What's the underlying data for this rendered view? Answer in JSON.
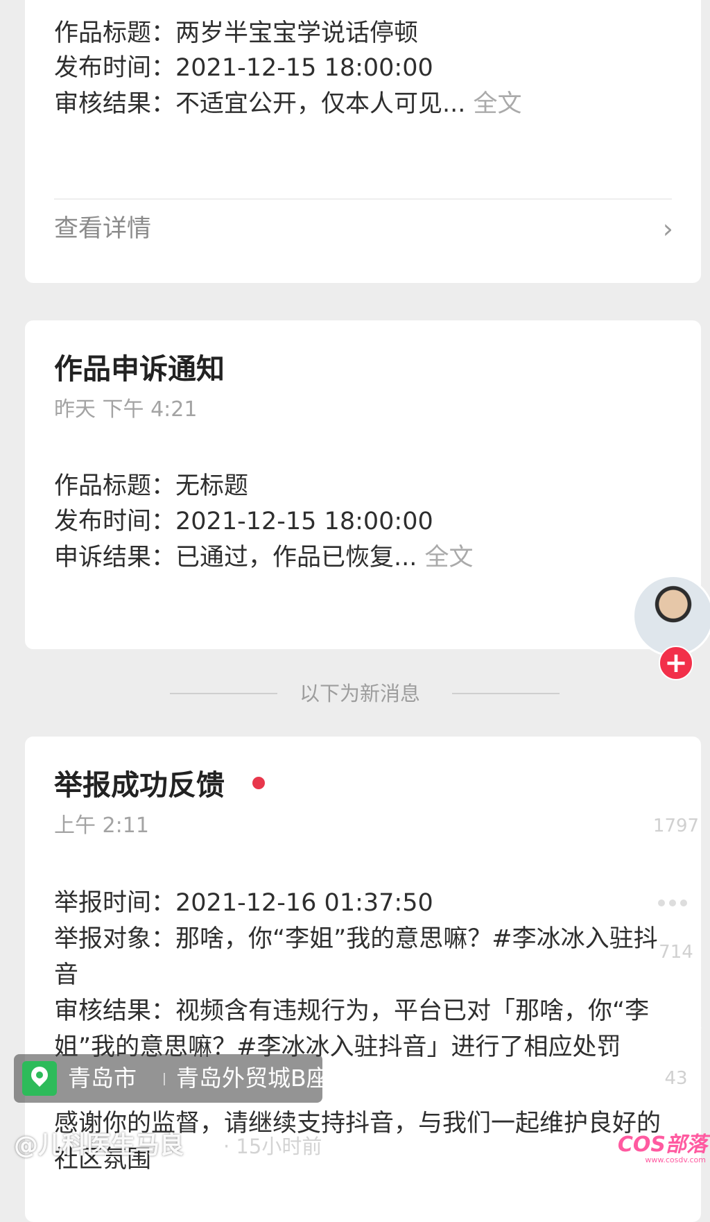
{
  "card1": {
    "lines": [
      {
        "label": "作品标题：",
        "value": "两岁半宝宝学说话停顿"
      },
      {
        "label": "发布时间：",
        "value": "2021-12-15 18:00:00"
      },
      {
        "label": "审核结果：",
        "value": "不适宜公开，仅本人可见...",
        "more": "全文"
      }
    ],
    "details_label": "查看详情",
    "chevron_icon": "chevron-right-icon"
  },
  "card2": {
    "title": "作品申诉通知",
    "time": "昨天 下午 4:21",
    "lines": [
      {
        "label": "作品标题：",
        "value": "无标题"
      },
      {
        "label": "发布时间：",
        "value": "2021-12-15 18:00:00"
      },
      {
        "label": "申诉结果：",
        "value": "已通过，作品已恢复...",
        "more": "全文"
      }
    ]
  },
  "separator": {
    "text": "以下为新消息"
  },
  "card3": {
    "title": "举报成功反馈",
    "time": "上午 2:11",
    "lines": [
      {
        "label": "举报时间：",
        "value": "2021-12-16 01:37:50"
      },
      {
        "label": "举报对象：",
        "value": "那啥，你“李姐”我的意思嘛？#李冰冰入驻抖"
      },
      {
        "label": "",
        "value": "音"
      },
      {
        "label": "审核结果：",
        "value": "视频含有违规行为，平台已对「那啥，你“李"
      },
      {
        "label": "",
        "value": "姐”我的意思嘛？#李冰冰入驻抖音」进行了相应处罚"
      },
      {
        "label": "",
        "value": "感谢你的监督，请继续支持抖音，与我们一起维护良好的"
      },
      {
        "label": "",
        "value": "社区氛围"
      }
    ]
  },
  "overlay": {
    "follow_symbol": "+",
    "like_count": "1797",
    "comment_count": "714",
    "share_count": "43",
    "location_city": "青岛市",
    "location_place": "青岛外贸城B座",
    "author": "@儿科医生马良",
    "time_ago": "· 15小时前",
    "watermark": "COS部落",
    "watermark_sub": "www.cosdv.com"
  },
  "colors": {
    "accent_red": "#e8374c",
    "location_green": "#2dbb5a"
  }
}
